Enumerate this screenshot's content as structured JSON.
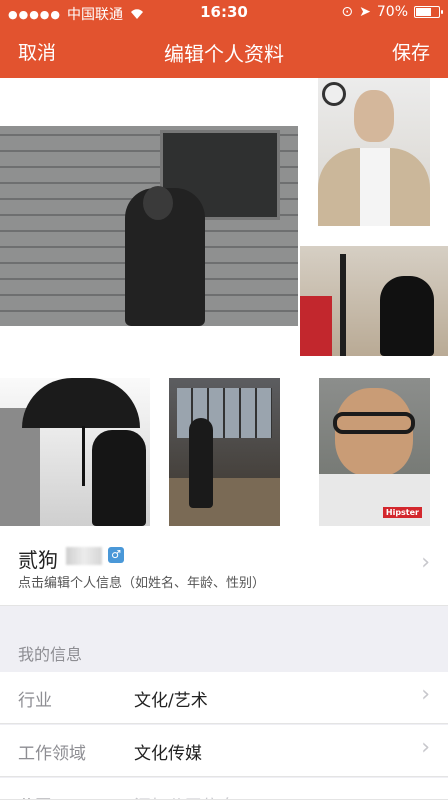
{
  "status_bar": {
    "signal_dots": "●●●●●",
    "carrier": "中国联通",
    "time": "16:30",
    "battery": "70%",
    "battery_level": 0.7
  },
  "nav": {
    "cancel": "取消",
    "title": "编辑个人资料",
    "save": "保存"
  },
  "profile": {
    "name": "贰狗",
    "gender_symbol": "♂",
    "hint": "点击编辑个人信息（如姓名、年龄、性别）"
  },
  "photo_badge": "Hipster",
  "my_info": {
    "section_label": "我的信息",
    "rows": [
      {
        "label": "行业",
        "value": "文化/艺术"
      },
      {
        "label": "工作领域",
        "value": "文化传媒"
      },
      {
        "label": "公司",
        "value": "添加公司信息"
      }
    ]
  },
  "chevron": "›",
  "colors": {
    "header": "#e2532f",
    "gender_badge": "#4a98d8"
  }
}
